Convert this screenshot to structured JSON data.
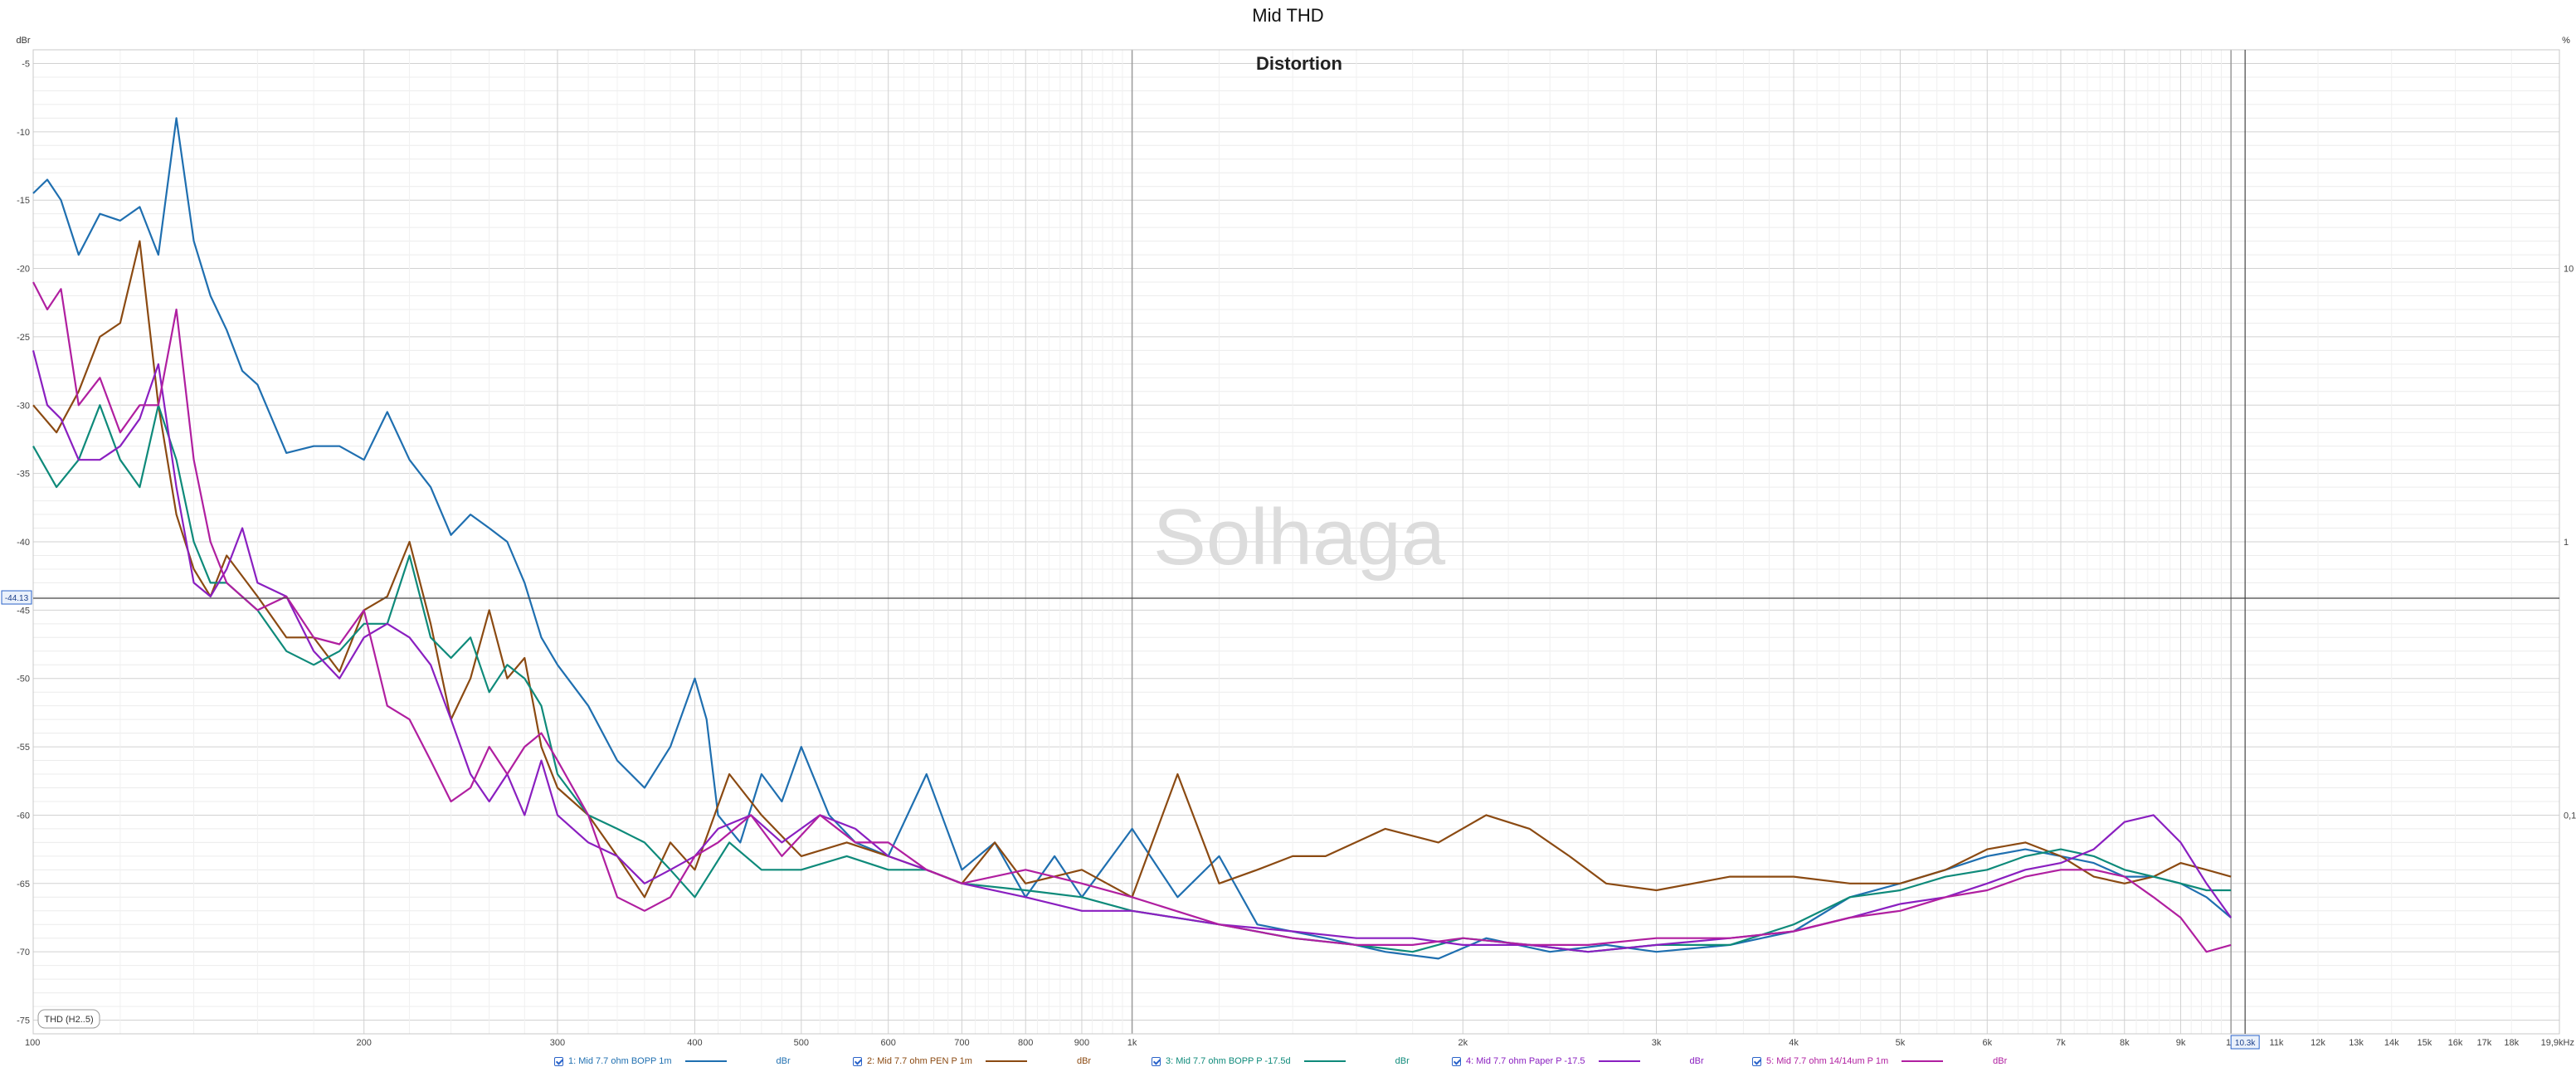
{
  "window": {
    "title": "Mid THD"
  },
  "legend_items": [
    {
      "label": "1: Mid 7.7 ohm BOPP 1m",
      "unit": "dBr",
      "color": "#1f6fb0"
    },
    {
      "label": "2: Mid 7.7 ohm PEN P 1m",
      "unit": "dBr",
      "color": "#8b4a12"
    },
    {
      "label": "3: Mid 7.7 ohm BOPP P -17.5d",
      "unit": "dBr",
      "color": "#0e8a7a"
    },
    {
      "label": "4: Mid 7.7 ohm Paper P -17.5",
      "unit": "dBr",
      "color": "#8a1fc0"
    },
    {
      "label": "5: Mid 7.7 ohm 14/14um P 1m",
      "unit": "dBr",
      "color": "#b01fa0"
    }
  ],
  "overlay": {
    "watermark": "Solhaga",
    "trace_label": "THD (H2..5)",
    "cursor_y_readout": "-44.13",
    "cursor_x_readout": "10.3k"
  },
  "chart_data": {
    "type": "line",
    "title": "Distortion",
    "xlabel": "",
    "ylabel": "dBr",
    "y2label": "%",
    "xscale": "log",
    "xlim": [
      100,
      19900
    ],
    "ylim": [
      -76,
      -4
    ],
    "grid": true,
    "legend_position": "bottom",
    "y_ticks": [
      -5,
      -10,
      -15,
      -20,
      -25,
      -30,
      -35,
      -40,
      -45,
      -50,
      -55,
      -60,
      -65,
      -70,
      -75
    ],
    "y_tick_labels": [
      "-5",
      "-10",
      "-15",
      "-20",
      "-25",
      "-30",
      "-35",
      "-40",
      "-45",
      "-50",
      "-55",
      "-60",
      "-65",
      "-70",
      "-75"
    ],
    "y2_ticks": [
      10,
      1,
      0.1
    ],
    "y2_tick_labels": [
      "10",
      "1",
      "0,1"
    ],
    "x_ticks": [
      100,
      200,
      300,
      400,
      500,
      600,
      700,
      800,
      900,
      1000,
      2000,
      3000,
      4000,
      5000,
      6000,
      7000,
      8000,
      9000,
      10000,
      11000,
      12000,
      13000,
      14000,
      15000,
      16000,
      17000,
      18000,
      19900
    ],
    "x_tick_labels": [
      "100",
      "200",
      "300",
      "400",
      "500",
      "600",
      "700",
      "800",
      "900",
      "1k",
      "2k",
      "3k",
      "4k",
      "5k",
      "6k",
      "7k",
      "8k",
      "9k",
      "10",
      "11k",
      "12k",
      "13k",
      "14k",
      "15k",
      "16k",
      "17k",
      "18k",
      "19,9kHz"
    ],
    "cursor": {
      "x": 10300,
      "y": -44.13
    },
    "series": [
      {
        "name": "1: Mid 7.7 ohm BOPP 1m",
        "color": "#1f6fb0",
        "x": [
          100,
          103,
          106,
          110,
          115,
          120,
          125,
          130,
          135,
          140,
          145,
          150,
          155,
          160,
          170,
          180,
          190,
          200,
          210,
          220,
          230,
          240,
          250,
          260,
          270,
          280,
          290,
          300,
          320,
          340,
          360,
          380,
          400,
          410,
          420,
          440,
          460,
          480,
          500,
          530,
          560,
          600,
          650,
          700,
          750,
          800,
          850,
          900,
          1000,
          1100,
          1200,
          1300,
          1500,
          1700,
          1900,
          2100,
          2400,
          2700,
          3000,
          3500,
          4000,
          4500,
          5000,
          5500,
          6000,
          6500,
          7000,
          7500,
          8000,
          8500,
          9000,
          9500,
          10000
        ],
        "y": [
          -14.5,
          -13.5,
          -15,
          -19,
          -16,
          -16.5,
          -15.5,
          -19,
          -9,
          -18,
          -22,
          -24.5,
          -27.5,
          -28.5,
          -33.5,
          -33,
          -33,
          -34,
          -30.5,
          -34,
          -36,
          -39.5,
          -38,
          -39,
          -40,
          -43,
          -47,
          -49,
          -52,
          -56,
          -58,
          -55,
          -50,
          -53,
          -60,
          -62,
          -57,
          -59,
          -55,
          -60,
          -62,
          -63,
          -57,
          -64,
          -62,
          -66,
          -63,
          -66,
          -61,
          -66,
          -63,
          -68,
          -69,
          -70,
          -70.5,
          -69,
          -70,
          -69.5,
          -70,
          -69.5,
          -68.5,
          -66,
          -65,
          -64,
          -63,
          -62.5,
          -63,
          -63.5,
          -64.5,
          -64.5,
          -65,
          -66,
          -67.5
        ]
      },
      {
        "name": "2: Mid 7.7 ohm PEN P 1m",
        "color": "#8b4a12",
        "x": [
          100,
          105,
          110,
          115,
          120,
          125,
          130,
          135,
          140,
          145,
          150,
          160,
          170,
          180,
          190,
          200,
          210,
          220,
          230,
          240,
          250,
          260,
          270,
          280,
          290,
          300,
          320,
          340,
          360,
          380,
          400,
          430,
          460,
          500,
          550,
          600,
          650,
          700,
          750,
          800,
          900,
          1000,
          1100,
          1200,
          1300,
          1400,
          1500,
          1700,
          1900,
          2100,
          2300,
          2500,
          2700,
          3000,
          3500,
          4000,
          4500,
          5000,
          5500,
          6000,
          6500,
          7000,
          7500,
          8000,
          8500,
          9000,
          9500,
          10000
        ],
        "y": [
          -30,
          -32,
          -29,
          -25,
          -24,
          -18,
          -30,
          -38,
          -42,
          -44,
          -41,
          -44,
          -47,
          -47,
          -49.5,
          -45,
          -44,
          -40,
          -46,
          -53,
          -50,
          -45,
          -50,
          -48.5,
          -55,
          -58,
          -60,
          -63,
          -66,
          -62,
          -64,
          -57,
          -60,
          -63,
          -62,
          -63,
          -64,
          -65,
          -62,
          -65,
          -64,
          -66,
          -57,
          -65,
          -64,
          -63,
          -63,
          -61,
          -62,
          -60,
          -61,
          -63,
          -65,
          -65.5,
          -64.5,
          -64.5,
          -65,
          -65,
          -64,
          -62.5,
          -62,
          -63,
          -64.5,
          -65,
          -64.5,
          -63.5,
          -64,
          -64.5
        ]
      },
      {
        "name": "3: Mid 7.7 ohm BOPP P -17.5d",
        "color": "#0e8a7a",
        "x": [
          100,
          105,
          110,
          115,
          120,
          125,
          130,
          135,
          140,
          145,
          150,
          160,
          170,
          180,
          190,
          200,
          210,
          220,
          230,
          240,
          250,
          260,
          270,
          280,
          290,
          300,
          320,
          340,
          360,
          380,
          400,
          430,
          460,
          500,
          550,
          600,
          650,
          700,
          800,
          900,
          1000,
          1200,
          1400,
          1600,
          1800,
          2000,
          2300,
          2600,
          3000,
          3500,
          4000,
          4500,
          5000,
          5500,
          6000,
          6500,
          7000,
          7500,
          8000,
          8500,
          9000,
          9500,
          10000
        ],
        "y": [
          -33,
          -36,
          -34,
          -30,
          -34,
          -36,
          -30,
          -34,
          -40,
          -43,
          -43,
          -45,
          -48,
          -49,
          -48,
          -46,
          -46,
          -41,
          -47,
          -48.5,
          -47,
          -51,
          -49,
          -50,
          -52,
          -57,
          -60,
          -61,
          -62,
          -64,
          -66,
          -62,
          -64,
          -64,
          -63,
          -64,
          -64,
          -65,
          -65.5,
          -66,
          -67,
          -68,
          -69,
          -69.5,
          -70,
          -69,
          -69.5,
          -70,
          -69.5,
          -69.5,
          -68,
          -66,
          -65.5,
          -64.5,
          -64,
          -63,
          -62.5,
          -63,
          -64,
          -64.5,
          -65,
          -65.5,
          -65.5
        ]
      },
      {
        "name": "4: Mid 7.7 ohm Paper P -17.5",
        "color": "#8a1fc0",
        "x": [
          100,
          103,
          106,
          110,
          115,
          120,
          125,
          130,
          135,
          140,
          145,
          150,
          155,
          160,
          170,
          180,
          190,
          200,
          210,
          220,
          230,
          240,
          250,
          260,
          270,
          280,
          290,
          300,
          320,
          340,
          360,
          380,
          400,
          420,
          450,
          480,
          520,
          560,
          600,
          650,
          700,
          800,
          900,
          1000,
          1200,
          1400,
          1600,
          1800,
          2000,
          2300,
          2600,
          3000,
          3500,
          4000,
          4500,
          5000,
          5500,
          6000,
          6500,
          7000,
          7500,
          8000,
          8500,
          9000,
          9500,
          10000
        ],
        "y": [
          -26,
          -30,
          -31,
          -34,
          -34,
          -33,
          -31,
          -27,
          -36,
          -43,
          -44,
          -42,
          -39,
          -43,
          -44,
          -48,
          -50,
          -47,
          -46,
          -47,
          -49,
          -53,
          -57,
          -59,
          -57,
          -60,
          -56,
          -60,
          -62,
          -63,
          -65,
          -64,
          -63,
          -61,
          -60,
          -62,
          -60,
          -61,
          -63,
          -64,
          -65,
          -66,
          -67,
          -67,
          -68,
          -68.5,
          -69,
          -69,
          -69.5,
          -69.5,
          -70,
          -69.5,
          -69,
          -68.5,
          -67.5,
          -66.5,
          -66,
          -65,
          -64,
          -63.5,
          -62.5,
          -60.5,
          -60,
          -62,
          -65,
          -67.5
        ]
      },
      {
        "name": "5: Mid 7.7 ohm 14/14um P 1m",
        "color": "#b01fa0",
        "x": [
          100,
          103,
          106,
          110,
          115,
          120,
          125,
          130,
          135,
          140,
          145,
          150,
          160,
          170,
          180,
          190,
          200,
          210,
          220,
          230,
          240,
          250,
          260,
          270,
          280,
          290,
          300,
          320,
          340,
          360,
          380,
          400,
          420,
          450,
          480,
          520,
          560,
          600,
          650,
          700,
          800,
          900,
          1000,
          1200,
          1400,
          1600,
          1800,
          2000,
          2300,
          2600,
          3000,
          3500,
          4000,
          4500,
          5000,
          5500,
          6000,
          6500,
          7000,
          7500,
          8000,
          8500,
          9000,
          9500,
          10000
        ],
        "y": [
          -21,
          -23,
          -21.5,
          -30,
          -28,
          -32,
          -30,
          -30,
          -23,
          -34,
          -40,
          -43,
          -45,
          -44,
          -47,
          -47.5,
          -45,
          -52,
          -53,
          -56,
          -59,
          -58,
          -55,
          -57,
          -55,
          -54,
          -56,
          -60,
          -66,
          -67,
          -66,
          -63,
          -62,
          -60,
          -63,
          -60,
          -62,
          -62,
          -64,
          -65,
          -64,
          -65,
          -66,
          -68,
          -69,
          -69.5,
          -69.5,
          -69,
          -69.5,
          -69.5,
          -69,
          -69,
          -68.5,
          -67.5,
          -67,
          -66,
          -65.5,
          -64.5,
          -64,
          -64,
          -64.5,
          -66,
          -67.5,
          -70,
          -69.5
        ]
      }
    ]
  }
}
